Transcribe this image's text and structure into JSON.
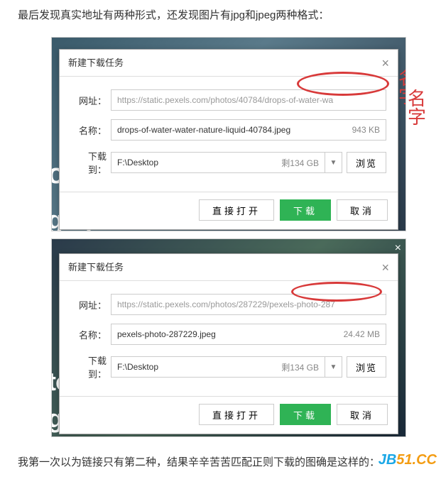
{
  "intro_text": "最后发现真实地址有两种形式，还发现图片有jpg和jpeg两种格式：",
  "outro_text": "我第一次以为链接只有第二种，结果辛辛苦苦匹配正则下载的图确是这样的：",
  "watermark": "JB51.CC",
  "dialog1": {
    "title": "新建下载任务",
    "url_label": "网址：",
    "url_value": "https://static.pexels.com/photos/40784/drops-of-water-wa",
    "name_label": "名称：",
    "name_value": "drops-of-water-water-nature-liquid-40784.jpeg",
    "name_size": "943 KB",
    "dl_label": "下载到：",
    "dl_value": "F:\\Desktop",
    "dl_free": "剩134 GB",
    "browse": "浏览",
    "open": "直接打开",
    "download": "下载",
    "cancel": "取消",
    "bg1": "o",
    "bg2": "graphicstock",
    "annotation": "名字"
  },
  "dialog2": {
    "title": "新建下载任务",
    "url_label": "网址：",
    "url_value": "https://static.pexels.com/photos/287229/pexels-photo-287",
    "name_label": "名称：",
    "name_value": "pexels-photo-287229.jpeg",
    "name_size": "24.42 MB",
    "dl_label": "下载到：",
    "dl_value": "F:\\Desktop",
    "dl_free": "剩134 GB",
    "browse": "浏览",
    "open": "直接打开",
    "download": "下载",
    "cancel": "取消",
    "bg1": "to",
    "bg2": "graphicstock",
    "outer_close": "×"
  }
}
